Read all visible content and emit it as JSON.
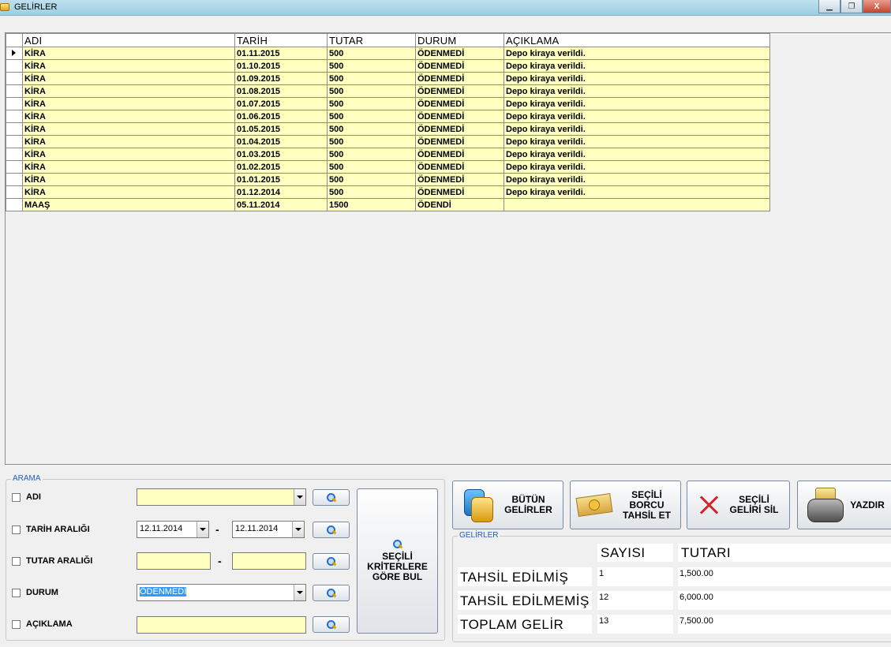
{
  "window": {
    "title": "GELİRLER",
    "min_icon": "minimize-icon",
    "max_icon": "maximize-icon",
    "close_label": "X"
  },
  "grid": {
    "columns": [
      "ADI",
      "TARİH",
      "TUTAR",
      "DURUM",
      "AÇIKLAMA"
    ],
    "rows": [
      [
        "KİRA",
        "01.11.2015",
        "500",
        "ÖDENMEDİ",
        "Depo kiraya verildi."
      ],
      [
        "KİRA",
        "01.10.2015",
        "500",
        "ÖDENMEDİ",
        "Depo kiraya verildi."
      ],
      [
        "KİRA",
        "01.09.2015",
        "500",
        "ÖDENMEDİ",
        "Depo kiraya verildi."
      ],
      [
        "KİRA",
        "01.08.2015",
        "500",
        "ÖDENMEDİ",
        "Depo kiraya verildi."
      ],
      [
        "KİRA",
        "01.07.2015",
        "500",
        "ÖDENMEDİ",
        "Depo kiraya verildi."
      ],
      [
        "KİRA",
        "01.06.2015",
        "500",
        "ÖDENMEDİ",
        "Depo kiraya verildi."
      ],
      [
        "KİRA",
        "01.05.2015",
        "500",
        "ÖDENMEDİ",
        "Depo kiraya verildi."
      ],
      [
        "KİRA",
        "01.04.2015",
        "500",
        "ÖDENMEDİ",
        "Depo kiraya verildi."
      ],
      [
        "KİRA",
        "01.03.2015",
        "500",
        "ÖDENMEDİ",
        "Depo kiraya verildi."
      ],
      [
        "KİRA",
        "01.02.2015",
        "500",
        "ÖDENMEDİ",
        "Depo kiraya verildi."
      ],
      [
        "KİRA",
        "01.01.2015",
        "500",
        "ÖDENMEDİ",
        "Depo kiraya verildi."
      ],
      [
        "KİRA",
        "01.12.2014",
        "500",
        "ÖDENMEDİ",
        "Depo kiraya verildi."
      ],
      [
        "MAAŞ",
        "05.11.2014",
        "1500",
        "ÖDENDİ",
        ""
      ]
    ],
    "current_row_index": 0
  },
  "search": {
    "group_title": "ARAMA",
    "adi_label": "ADI",
    "adi_value": "",
    "tarih_label": "TARİH ARALIĞI",
    "tarih_from": "12.11.2014",
    "tarih_to": "12.11.2014",
    "tutar_label": "TUTAR ARALIĞI",
    "tutar_from": "",
    "tutar_to": "",
    "durum_label": "DURUM",
    "durum_value": "ÖDENMEDİ",
    "aciklama_label": "AÇIKLAMA",
    "aciklama_value": "",
    "range_separator": "-",
    "big_button_line1": "SEÇİLİ",
    "big_button_line2": "KRİTERLERE",
    "big_button_line3": "GÖRE BUL"
  },
  "actions": {
    "all_line1": "BÜTÜN",
    "all_line2": "GELİRLER",
    "collect_line1": "SEÇİLİ",
    "collect_line2": "BORCU",
    "collect_line3": "TAHSİL ET",
    "delete_line1": "SEÇİLİ",
    "delete_line2": "GELİRİ SİL",
    "print_label": "YAZDIR"
  },
  "summary": {
    "group_title": "GELİRLER",
    "col_count": "SAYISI",
    "col_amount": "TUTARI",
    "rows": [
      {
        "label": "TAHSİL EDİLMİŞ",
        "count": "1",
        "amount": "1,500.00"
      },
      {
        "label": "TAHSİL EDİLMEMİŞ",
        "count": "12",
        "amount": "6,000.00"
      },
      {
        "label": "TOPLAM GELİR",
        "count": "13",
        "amount": "7,500.00"
      }
    ]
  },
  "colors": {
    "cell_bg": "#ffffc0",
    "selection": "#3399ff",
    "group_label": "#2060c0"
  }
}
